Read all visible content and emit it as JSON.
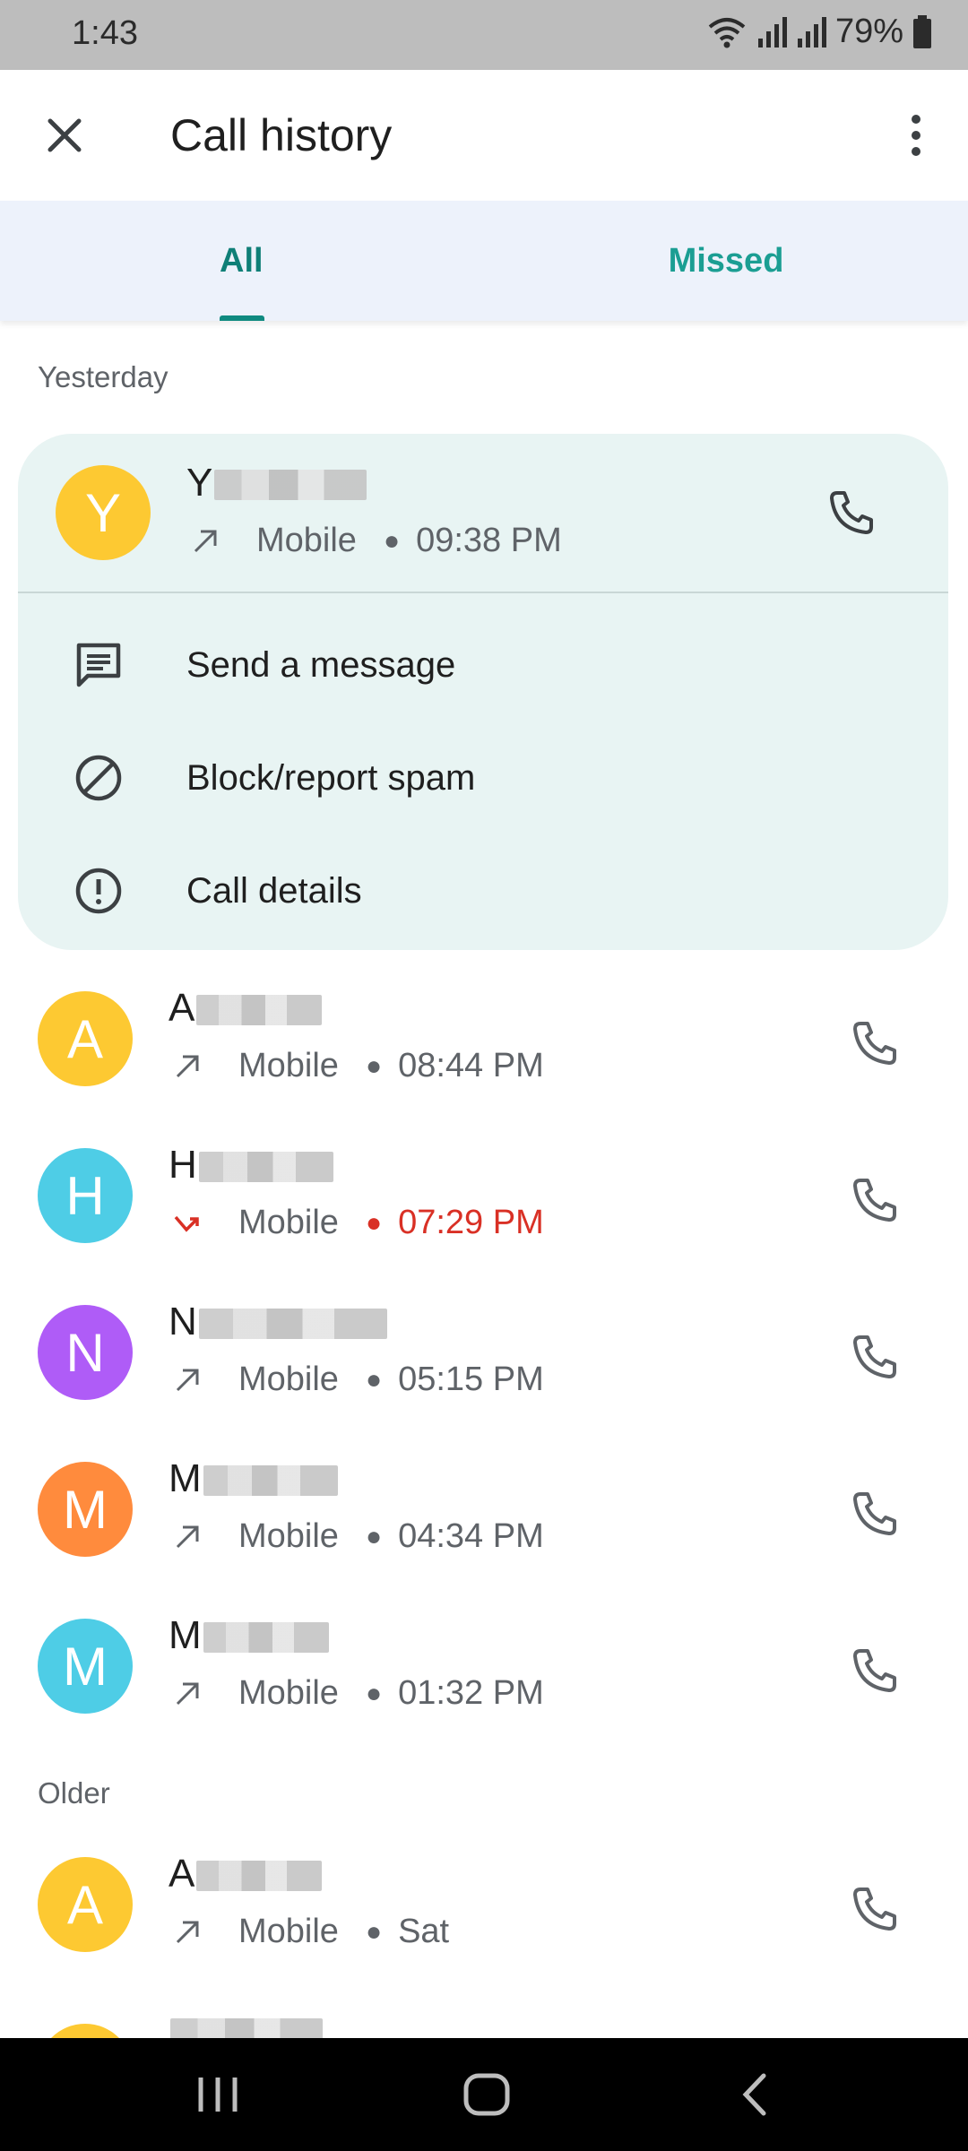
{
  "status_bar": {
    "time": "1:43",
    "battery": "79%"
  },
  "app_bar": {
    "title": "Call history"
  },
  "tabs": [
    {
      "label": "All",
      "selected": true
    },
    {
      "label": "Missed",
      "selected": false
    }
  ],
  "sections": {
    "yesterday": "Yesterday",
    "older": "Older"
  },
  "expanded_call": {
    "initial": "Y",
    "name_visible": "Y",
    "type": "Mobile",
    "time": "09:38 PM",
    "avatar_color": "#fdc932"
  },
  "actions": [
    {
      "label": "Send a message"
    },
    {
      "label": "Block/report spam"
    },
    {
      "label": "Call details"
    }
  ],
  "calls": [
    {
      "initial": "A",
      "name_visible": "A",
      "type": "Mobile",
      "time": "08:44 PM",
      "direction": "outgoing",
      "avatar_color": "#fdc932"
    },
    {
      "initial": "H",
      "name_visible": "H",
      "type": "Mobile",
      "time": "07:29 PM",
      "direction": "missed",
      "avatar_color": "#4ecde6"
    },
    {
      "initial": "N",
      "name_visible": "N",
      "type": "Mobile",
      "time": "05:15 PM",
      "direction": "outgoing",
      "avatar_color": "#af5cf7"
    },
    {
      "initial": "M",
      "name_visible": "M",
      "type": "Mobile",
      "time": "04:34 PM",
      "direction": "outgoing",
      "avatar_color": "#ff8b3d"
    },
    {
      "initial": "M",
      "name_visible": "M",
      "type": "Mobile",
      "time": "01:32 PM",
      "direction": "outgoing",
      "avatar_color": "#4ecde6"
    }
  ],
  "older_calls": [
    {
      "initial": "A",
      "name_visible": "A",
      "type": "Mobile",
      "time": "Sat",
      "direction": "outgoing",
      "avatar_color": "#fdc932"
    }
  ],
  "colors": {
    "accent": "#0f8a80",
    "missed": "#d93025"
  }
}
